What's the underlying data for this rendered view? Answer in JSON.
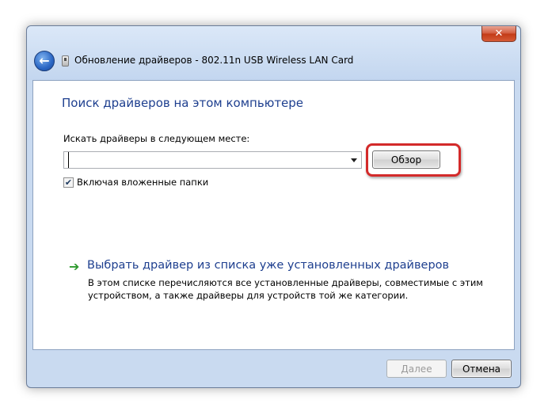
{
  "window": {
    "title": "Обновление драйверов - 802.11n USB Wireless LAN Card",
    "close_glyph": "✕",
    "back_glyph": "←"
  },
  "main": {
    "heading": "Поиск драйверов на этом компьютере",
    "location_label": "Искать драйверы в следующем месте:",
    "path_value": "",
    "browse_label": "Обзор",
    "include_subfolders_label": "Включая вложенные папки",
    "include_subfolders_checked": true,
    "check_glyph": "✔"
  },
  "pick_option": {
    "arrow_glyph": "➔",
    "link_text": "Выбрать драйвер из списка уже установленных драйверов",
    "description": "В этом списке перечисляются все установленные драйверы, совместимые с этим устройством, а также драйверы для устройств той же категории."
  },
  "footer": {
    "next_label": "Далее",
    "cancel_label": "Отмена"
  },
  "colors": {
    "heading_blue": "#1e3f8f",
    "highlight_red": "#d32a2a",
    "arrow_green": "#2e9a2e"
  }
}
